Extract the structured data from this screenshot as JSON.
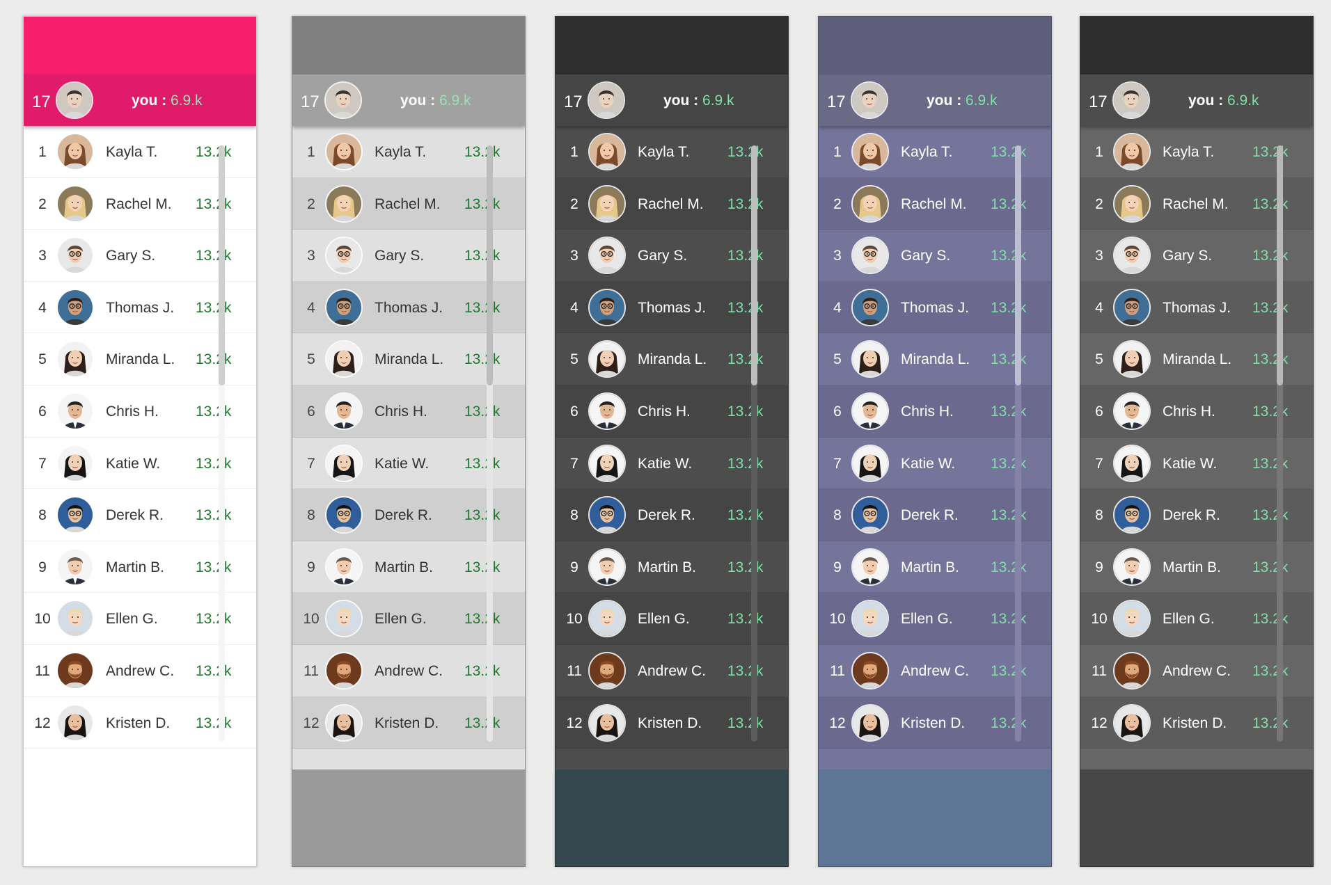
{
  "you": {
    "rank": "17",
    "label": "you",
    "separator": ":",
    "score": "6.9.k"
  },
  "players": [
    {
      "rank": "1",
      "name": "Kayla T.",
      "score": "13.2k",
      "avatar": "woman-brown-hair-avatar"
    },
    {
      "rank": "2",
      "name": "Rachel M.",
      "score": "13.2k",
      "avatar": "woman-blonde-hair-avatar"
    },
    {
      "rank": "3",
      "name": "Gary S.",
      "score": "13.2k",
      "avatar": "man-glasses-avatar"
    },
    {
      "rank": "4",
      "name": "Thomas J.",
      "score": "13.2k",
      "avatar": "man-sunglasses-avatar"
    },
    {
      "rank": "5",
      "name": "Miranda L.",
      "score": "13.2k",
      "avatar": "woman-dark-hair-avatar"
    },
    {
      "rank": "6",
      "name": "Chris H.",
      "score": "13.2k",
      "avatar": "man-suit-avatar"
    },
    {
      "rank": "7",
      "name": "Katie W.",
      "score": "13.2k",
      "avatar": "woman-black-hair-avatar"
    },
    {
      "rank": "8",
      "name": "Derek R.",
      "score": "13.2k",
      "avatar": "man-glasses-blue-avatar"
    },
    {
      "rank": "9",
      "name": "Martin B.",
      "score": "13.2k",
      "avatar": "man-suit-smiling-avatar"
    },
    {
      "rank": "10",
      "name": "Ellen G.",
      "score": "13.2k",
      "avatar": "woman-short-blonde-avatar"
    },
    {
      "rank": "11",
      "name": "Andrew C.",
      "score": "13.2k",
      "avatar": "man-beard-avatar"
    },
    {
      "rank": "12",
      "name": "Kristen D.",
      "score": "13.2k",
      "avatar": "woman-dark-long-hair-avatar"
    }
  ],
  "themes": [
    {
      "id": "pink",
      "top_bg": "#f71e6b",
      "you_bg": "#e01c6a",
      "list_bg": "#ffffff",
      "row_alt_bg": "#ffffff",
      "bottom_bg": "#ffffff",
      "rank_color": "#333333",
      "name_color": "#333333",
      "score_color": "#1d7a2e",
      "you_score_color": "#9ae0b4",
      "track_color": "#f5f5f5",
      "thumb_color": "#cfcfcf",
      "border": "#c9c9c9"
    },
    {
      "id": "light-gray",
      "top_bg": "#808080",
      "you_bg": "#a1a1a1",
      "list_bg": "#e0e0e0",
      "row_alt_bg": "#cfcfcf",
      "bottom_bg": "#9a9a9a",
      "rank_color": "#444444",
      "name_color": "#333333",
      "score_color": "#1d7a2e",
      "you_score_color": "#9ae0b4",
      "track_color": "#e6e6e6",
      "thumb_color": "#bdbdbd",
      "border": "#8a8a8a"
    },
    {
      "id": "dark-slate",
      "top_bg": "#2f2f2f",
      "you_bg": "#454545",
      "list_bg": "#4d4d4d",
      "row_alt_bg": "#454545",
      "bottom_bg": "#35474f",
      "rank_color": "#ffffff",
      "name_color": "#ffffff",
      "score_color": "#7fe0a8",
      "you_score_color": "#7fe0a8",
      "track_color": "#5c5c5c",
      "thumb_color": "#bdbdbd",
      "border": "#333333"
    },
    {
      "id": "purple-gray",
      "top_bg": "#5f5e7a",
      "you_bg": "#6a6986",
      "list_bg": "#75749a",
      "row_alt_bg": "#6b6a8e",
      "bottom_bg": "#5f7596",
      "rank_color": "#ffffff",
      "name_color": "#ffffff",
      "score_color": "#7fe0a8",
      "you_score_color": "#7fe0a8",
      "track_color": "#8584a8",
      "thumb_color": "#bdbdd4",
      "border": "#55546c"
    },
    {
      "id": "charcoal",
      "top_bg": "#2e2e2e",
      "you_bg": "#4d4d4d",
      "list_bg": "#666666",
      "row_alt_bg": "#5c5c5c",
      "bottom_bg": "#474747",
      "rank_color": "#ffffff",
      "name_color": "#ffffff",
      "score_color": "#7fe0a8",
      "you_score_color": "#7fe0a8",
      "track_color": "#777777",
      "thumb_color": "#b8b8b8",
      "border": "#333333"
    }
  ]
}
